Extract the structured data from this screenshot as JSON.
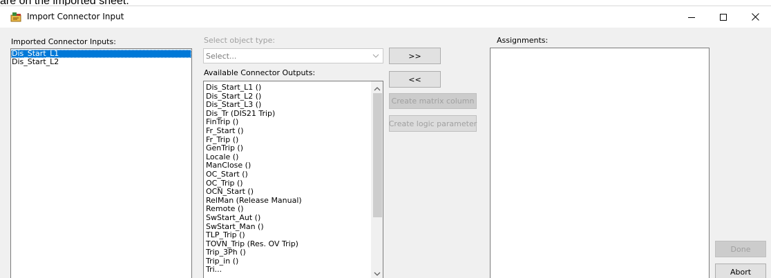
{
  "doc": {
    "snippet": "are on the imported sheet."
  },
  "window": {
    "title": "Import Connector Input",
    "controls": {
      "minimize": "—",
      "maximize": "☐",
      "close": "✕"
    }
  },
  "imported": {
    "label": "Imported Connector Inputs:",
    "items": [
      "Dis_Start_L1",
      "Dis_Start_L2"
    ],
    "selected_index": 0
  },
  "object_type": {
    "label": "Select object type:",
    "value": "Select..."
  },
  "outputs": {
    "label": "Available Connector Outputs:",
    "items": [
      "Dis_Start_L1 ()",
      "Dis_Start_L2 ()",
      "Dis_Start_L3 ()",
      "Dis_Tr (DIS21 Trip)",
      "FinTrip ()",
      "Fr_Start ()",
      "Fr_Trip ()",
      "GenTrip ()",
      "Locale ()",
      "ManClose ()",
      "OC_Start ()",
      "OC_Trip ()",
      "OCN_Start ()",
      "RelMan (Release Manual)",
      "Remote ()",
      "SwStart_Aut ()",
      "SwStart_Man ()",
      "TLP_Trip ()",
      "TOVN_Trip (Res. OV Trip)",
      "Trip_3Ph ()",
      "Trip_in ()",
      "Tri..."
    ]
  },
  "buttons": {
    "add": ">>",
    "remove": "<<",
    "create_matrix": "Create matrix column",
    "create_logic": "Create logic parameter",
    "done": "Done",
    "abort": "Abort"
  },
  "assignments": {
    "label": "Assignments:"
  }
}
